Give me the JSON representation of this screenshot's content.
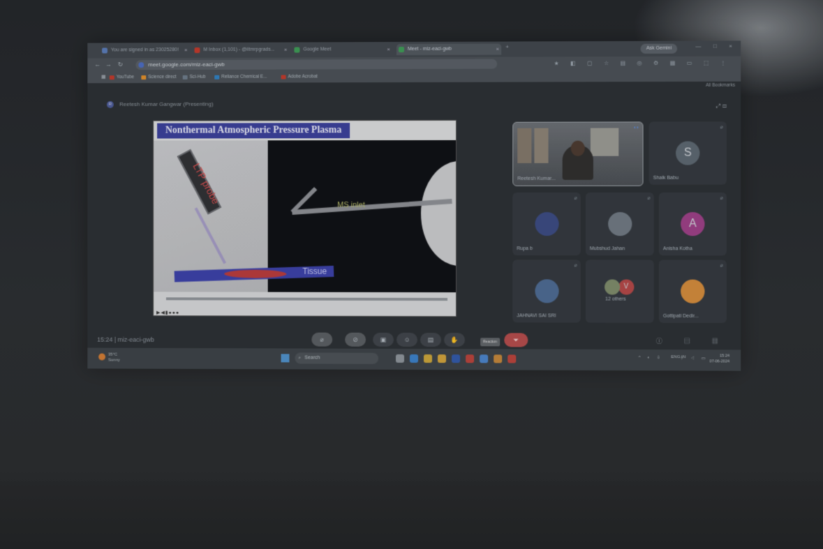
{
  "browser": {
    "tabs": [
      {
        "label": "You are signed in as 23025280!"
      },
      {
        "label": "M  Inbox (1,101) - @iitmrpgrads..."
      },
      {
        "label": "Google Meet"
      },
      {
        "label": "Meet - miz-eaci-gwb",
        "active": true
      }
    ],
    "gemini_label": "Ask Gemini",
    "url": "meet.google.com/miz-eaci-gwb",
    "bookmarks": [
      {
        "label": "YouTube",
        "color": "#c0392b"
      },
      {
        "label": "Science direct",
        "color": "#e08e2a"
      },
      {
        "label": "Sci-Hub",
        "color": "#6c7a89"
      },
      {
        "label": "Reliance Chemical E...",
        "color": "#2f7fc1"
      },
      {
        "label": "Adobe Acrobat",
        "color": "#c0392b"
      }
    ],
    "all_bookmarks": "All Bookmarks"
  },
  "meet": {
    "presenter_text": "Reetesh Kumar Gangwar (Presenting)",
    "slide": {
      "title": "Nonthermal Atmospheric Pressure Plasma",
      "probe_label": "LTP probe",
      "ms_label": "MS inlet",
      "tissue_label": "Tissue"
    },
    "participants": [
      {
        "name": "Reetesh Kumar...",
        "type": "video"
      },
      {
        "name": "Shaik Babu",
        "initial": "S",
        "color": "#5c6670"
      },
      {
        "name": "Rupa b",
        "initial": "",
        "color": "#3b4a82"
      },
      {
        "name": "Mubshud Jahan",
        "initial": "",
        "color": "#6f7882"
      },
      {
        "name": "Anisha Kotha",
        "initial": "A",
        "color": "#9c3f86"
      },
      {
        "name": "JAHNAVI SAI SRI",
        "initial": "",
        "color": "#4d6a92"
      },
      {
        "name": "12 others",
        "initial": "V",
        "color": "#b24747"
      },
      {
        "name": "Gottipati Dedir...",
        "initial": "",
        "color": "#d28a3b"
      }
    ],
    "time_code": "15:24 | miz-eaci-gwb",
    "tooltip": "Reaction"
  },
  "taskbar": {
    "weather_temp": "35°C",
    "weather_desc": "Sunny",
    "search_placeholder": "Search",
    "lang": "ENG IN",
    "time": "15:24",
    "date": "07-06-2024"
  }
}
